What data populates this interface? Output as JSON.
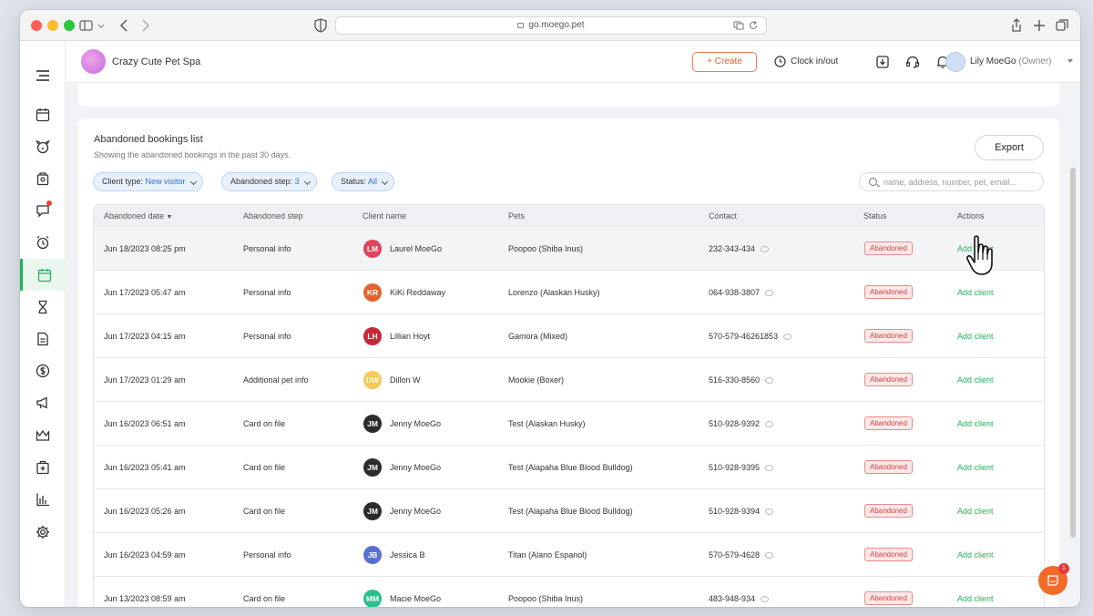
{
  "browser": {
    "url": "go.moego.pet"
  },
  "header": {
    "business_name": "Crazy Cute Pet Spa",
    "create_label": "+ Create",
    "clock_label": "Clock in/out",
    "user_name": "Lily MoeGo",
    "user_role": "(Owner)"
  },
  "card": {
    "title": "Abandoned bookings list",
    "subtitle": "Showing the abandoned bookings in the past 30 days.",
    "export_label": "Export"
  },
  "filters": {
    "client_type_label": "Client type:",
    "client_type_value": "New visitor",
    "abandoned_step_label": "Abandoned step:",
    "abandoned_step_value": "3",
    "status_label": "Status:",
    "status_value": "All"
  },
  "search": {
    "placeholder": "name, address, number, pet, email..."
  },
  "table": {
    "columns": [
      "Abandoned date",
      "Abandoned step",
      "Client name",
      "Pets",
      "Contact",
      "Status",
      "Actions"
    ],
    "rows": [
      {
        "date": "Jun 18/2023 08:25 pm",
        "step": "Personal info",
        "initials": "LM",
        "avatar_color": "#e0435a",
        "client": "Laurel MoeGo",
        "pets": "Poopoo (Shiba Inus)",
        "contact": "232-343-434",
        "status": "Abandoned",
        "action": "Add client"
      },
      {
        "date": "Jun 17/2023 05:47 am",
        "step": "Personal info",
        "initials": "KR",
        "avatar_color": "#e4622f",
        "client": "KiKi Reddaway",
        "pets": "Lorenzo (Alaskan Husky)",
        "contact": "064-938-3807",
        "status": "Abandoned",
        "action": "Add client"
      },
      {
        "date": "Jun 17/2023 04:15 am",
        "step": "Personal info",
        "initials": "LH",
        "avatar_color": "#c9283a",
        "client": "Lillian Hoyt",
        "pets": "Gamora (Mixed)",
        "contact": "570-579-46261853",
        "status": "Abandoned",
        "action": "Add client"
      },
      {
        "date": "Jun 17/2023 01:29 am",
        "step": "Additional pet info",
        "initials": "DW",
        "avatar_color": "#f5c85a",
        "client": "Dillon W",
        "pets": "Mookie (Boxer)",
        "contact": "516-330-8560",
        "status": "Abandoned",
        "action": "Add client"
      },
      {
        "date": "Jun 16/2023 06:51 am",
        "step": "Card on file",
        "initials": "JM",
        "avatar_color": "#2b2b2b",
        "client": "Jenny MoeGo",
        "pets": "Test (Alaskan Husky)",
        "contact": "510-928-9392",
        "status": "Abandoned",
        "action": "Add client"
      },
      {
        "date": "Jun 16/2023 05:41 am",
        "step": "Card on file",
        "initials": "JM",
        "avatar_color": "#2b2b2b",
        "client": "Jenny MoeGo",
        "pets": "Test (Alapaha Blue Blood Bulldog)",
        "contact": "510-928-9395",
        "status": "Abandoned",
        "action": "Add client"
      },
      {
        "date": "Jun 16/2023 05:26 am",
        "step": "Card on file",
        "initials": "JM",
        "avatar_color": "#2b2b2b",
        "client": "Jenny MoeGo",
        "pets": "Test (Alapaha Blue Blood Bulldog)",
        "contact": "510-928-9394",
        "status": "Abandoned",
        "action": "Add client"
      },
      {
        "date": "Jun 16/2023 04:59 am",
        "step": "Personal info",
        "initials": "JB",
        "avatar_color": "#5a6fd6",
        "client": "Jessica B",
        "pets": "Titan (Alano Espanol)",
        "contact": "570-579-4628",
        "status": "Abandoned",
        "action": "Add client"
      },
      {
        "date": "Jun 13/2023 08:59 am",
        "step": "Card on file",
        "initials": "MM",
        "avatar_color": "#27c08a",
        "client": "Macie MoeGo",
        "pets": "Poopoo (Shiba Inus)",
        "contact": "483-948-934",
        "status": "Abandoned",
        "action": "Add client"
      }
    ]
  },
  "chat": {
    "unread": "1"
  },
  "colors": {
    "accent": "#27b15d",
    "create": "#f15a2a",
    "status": "#d94040"
  }
}
